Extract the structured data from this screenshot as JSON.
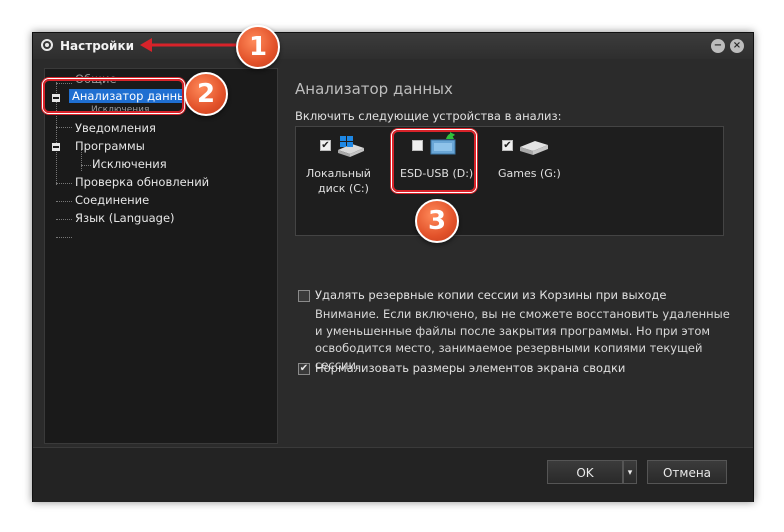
{
  "window": {
    "title": "Настройки",
    "minimize_glyph": "−",
    "close_glyph": "×"
  },
  "sidebar": {
    "items": [
      {
        "label": "Общие"
      },
      {
        "label": "Анализатор данных",
        "selected": true
      },
      {
        "label": "Исключения"
      },
      {
        "label": "Уведомления"
      },
      {
        "label": "Программы"
      },
      {
        "label": "Исключения"
      },
      {
        "label": "Проверка обновлений"
      },
      {
        "label": "Соединение"
      },
      {
        "label": "Язык (Language)"
      }
    ]
  },
  "main": {
    "section_title": "Анализатор данных",
    "include_label": "Включить следующие устройства в анализ:",
    "devices": [
      {
        "label_line1": "Локальный",
        "label_line2": "диск (C:)",
        "checked": true,
        "icon": "windows-drive-icon"
      },
      {
        "label_line1": "ESD-USB (D:)",
        "label_line2": "",
        "checked": false,
        "icon": "usb-drive-icon"
      },
      {
        "label_line1": "Games (G:)",
        "label_line2": "",
        "checked": true,
        "icon": "drive-icon"
      }
    ],
    "options": {
      "delete_backups_label": "Удалять резервные копии сессии из Корзины при выходе",
      "delete_backups_checked": false,
      "note": "Внимание. Если включено, вы не сможете восстановить удаленные и уменьшенные файлы после закрытия программы. Но при этом освободится место, занимаемое резервными копиями текущей сессии.",
      "normalize_label": "Нормализовать размеры элементов экрана сводки",
      "normalize_checked": true
    }
  },
  "footer": {
    "ok_label": "OK",
    "dropdown_glyph": "▾",
    "cancel_label": "Отмена"
  },
  "callouts": {
    "badge1": "1",
    "badge2": "2",
    "badge3": "3",
    "color": "#d8232a"
  },
  "check_glyph": "✔"
}
